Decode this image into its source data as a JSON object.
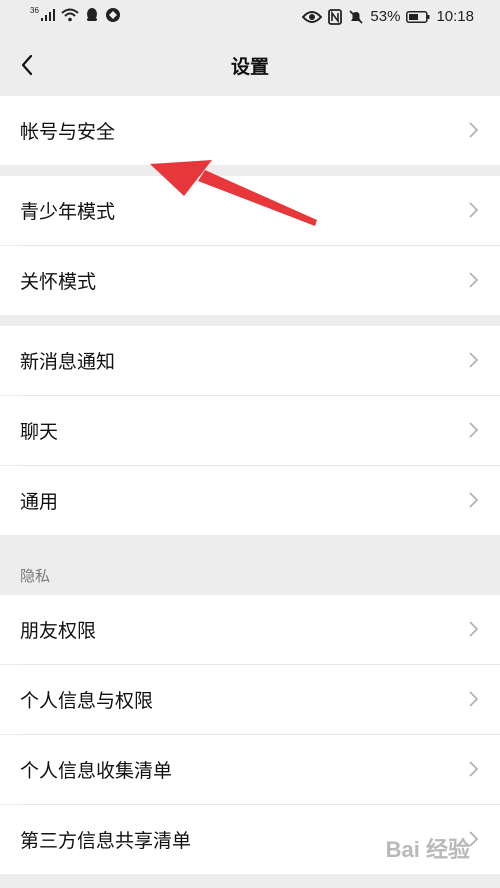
{
  "status_bar": {
    "network": "36",
    "battery_percent": "53%",
    "time": "10:18"
  },
  "header": {
    "title": "设置"
  },
  "settings": {
    "account_security": "帐号与安全",
    "teen_mode": "青少年模式",
    "care_mode": "关怀模式",
    "new_message_notification": "新消息通知",
    "chat": "聊天",
    "general": "通用",
    "privacy_header": "隐私",
    "friend_permissions": "朋友权限",
    "personal_info_permissions": "个人信息与权限",
    "personal_info_collection": "个人信息收集清单",
    "third_party_sharing": "第三方信息共享清单"
  },
  "watermark": "Bai 经验"
}
